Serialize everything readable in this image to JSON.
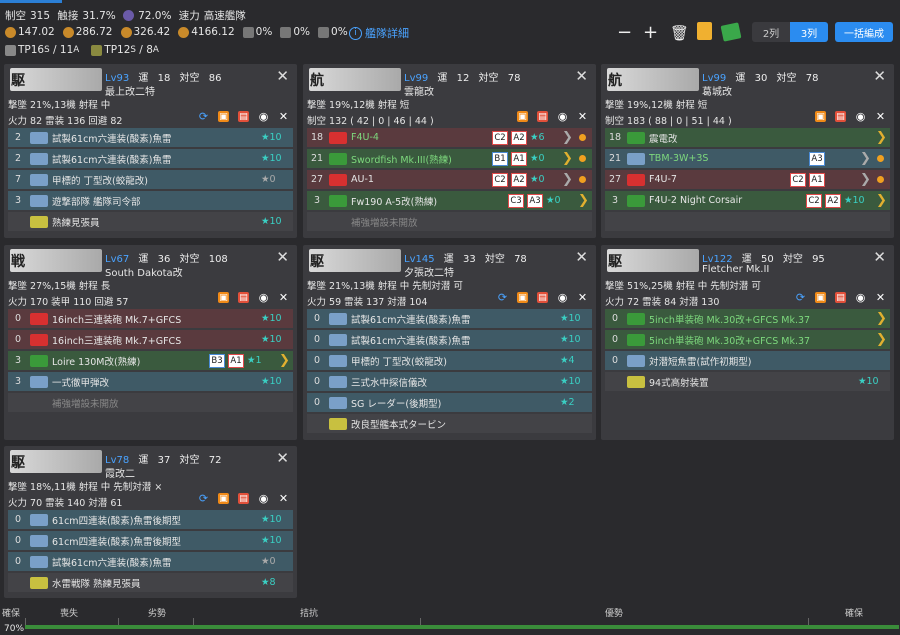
{
  "header": {
    "air_label": "制空",
    "air_value": "315",
    "contact_label": "触接",
    "contact_value": "31.7%",
    "ship_icon": "ship-emblem-icon",
    "unknown_value": "72.0%",
    "speed_label": "速力",
    "speed_value": "高速艦隊",
    "los": [
      "147.02",
      "286.72",
      "326.42",
      "4166.12"
    ],
    "fuel_pct": "0%",
    "ammo_pct": "0%",
    "steel_pct": "0%",
    "detail_link": "艦隊詳細",
    "col2": "2列",
    "col3": "3列",
    "bulk": "一括編成",
    "tp_label": "TP",
    "tp_s_value": "16",
    "tp_s_sub": "S",
    "tp_a_value": "11",
    "tp_a_sub": "A",
    "tp2_s_value": "12",
    "tp2_s_sub": "S",
    "tp2_a_value": "8",
    "tp2_a_sub": "A"
  },
  "ships": [
    {
      "banner": "駆",
      "level": "Lv93",
      "luck_label": "運",
      "luck": "18",
      "aa_label": "対空",
      "aa": "86",
      "name": "最上改二特",
      "line1": "撃墜 21%,13機  射程 中",
      "line2": "火力 82  雷装 136  回避 82",
      "equips": [
        {
          "slot": "2",
          "name": "試製61cm六連装(酸素)魚雷",
          "imp": "★10",
          "kind": "b"
        },
        {
          "slot": "2",
          "name": "試製61cm六連装(酸素)魚雷",
          "imp": "★10",
          "kind": "b"
        },
        {
          "slot": "7",
          "name": "甲標的 丁型改(蛟龍改)",
          "imp": "★0",
          "kind": "b",
          "gray": true
        },
        {
          "slot": "3",
          "name": "遊撃部隊 艦隊司令部",
          "imp": "",
          "kind": "b"
        },
        {
          "slot": "",
          "name": "熟練見張員",
          "imp": "★10",
          "kind": "ex"
        }
      ]
    },
    {
      "banner": "航",
      "level": "Lv99",
      "luck_label": "運",
      "luck": "12",
      "aa_label": "対空",
      "aa": "78",
      "name": "雲龍改",
      "line1": "撃墜 19%,12機  射程 短",
      "line2": "制空 132 ( 42 | 0 | 46 | 44 )",
      "equips": [
        {
          "slot": "18",
          "name": "F4U-4",
          "imp": "★6",
          "kind": "r",
          "green": true,
          "tags": [
            "C2",
            "A2"
          ]
        },
        {
          "slot": "21",
          "name": "Swordfish Mk.III(熟練)",
          "imp": "★0",
          "kind": "g",
          "green": true,
          "tags": [
            "B1",
            "A1"
          ]
        },
        {
          "slot": "27",
          "name": "AU-1",
          "imp": "★0",
          "kind": "r",
          "tags": [
            "C2",
            "A2"
          ]
        },
        {
          "slot": "3",
          "name": "Fw190 A-5改(熟練)",
          "imp": "★0",
          "kind": "g",
          "tags": [
            "C3",
            "A3"
          ]
        },
        {
          "slot": "",
          "name": "補強増設未開放",
          "imp": "",
          "kind": "ex",
          "dim": true
        }
      ]
    },
    {
      "banner": "航",
      "level": "Lv99",
      "luck_label": "運",
      "luck": "30",
      "aa_label": "対空",
      "aa": "78",
      "name": "葛城改",
      "line1": "撃墜 19%,12機  射程 短",
      "line2": "制空 183 ( 88 | 0 | 51 | 44 )",
      "equips": [
        {
          "slot": "18",
          "name": "震電改",
          "imp": "",
          "kind": "g"
        },
        {
          "slot": "21",
          "name": "TBM-3W+3S",
          "imp": "",
          "kind": "b",
          "green": true,
          "tags": [
            "A3"
          ]
        },
        {
          "slot": "27",
          "name": "F4U-7",
          "imp": "",
          "kind": "r",
          "tags": [
            "C2",
            "A1"
          ]
        },
        {
          "slot": "3",
          "name": "F4U-2 Night Corsair",
          "imp": "★10",
          "kind": "g",
          "tags": [
            "C2",
            "A2"
          ]
        },
        {
          "slot": "",
          "name": "",
          "imp": "",
          "kind": "ex"
        }
      ]
    },
    {
      "banner": "戦",
      "level": "Lv67",
      "luck_label": "運",
      "luck": "36",
      "aa_label": "対空",
      "aa": "108",
      "name": "South Dakota改",
      "line1": "撃墜 27%,15機  射程 長",
      "line2": "火力 170  装甲 110  回避 57",
      "equips": [
        {
          "slot": "0",
          "name": "16inch三連装砲 Mk.7+GFCS",
          "imp": "★10",
          "kind": "r"
        },
        {
          "slot": "0",
          "name": "16inch三連装砲 Mk.7+GFCS",
          "imp": "★10",
          "kind": "r"
        },
        {
          "slot": "3",
          "name": "Loire 130M改(熟練)",
          "imp": "★1",
          "kind": "g",
          "tags": [
            "B3",
            "A1"
          ]
        },
        {
          "slot": "3",
          "name": "一式徹甲弾改",
          "imp": "★10",
          "kind": "b"
        },
        {
          "slot": "",
          "name": "補強増設未開放",
          "imp": "",
          "kind": "ex",
          "dim": true
        }
      ]
    },
    {
      "banner": "駆",
      "level": "Lv145",
      "luck_label": "運",
      "luck": "33",
      "aa_label": "対空",
      "aa": "78",
      "name": "夕張改二特",
      "line1": "撃墜 21%,13機  射程 中  先制対潜 可",
      "line2": "火力 59  雷装 137  対潜 104",
      "equips": [
        {
          "slot": "0",
          "name": "試製61cm六連装(酸素)魚雷",
          "imp": "★10",
          "kind": "b"
        },
        {
          "slot": "0",
          "name": "試製61cm六連装(酸素)魚雷",
          "imp": "★10",
          "kind": "b"
        },
        {
          "slot": "0",
          "name": "甲標的 丁型改(蛟龍改)",
          "imp": "★4",
          "kind": "b"
        },
        {
          "slot": "0",
          "name": "三式水中探信儀改",
          "imp": "★10",
          "kind": "b"
        },
        {
          "slot": "0",
          "name": "SG レーダー(後期型)",
          "imp": "★2",
          "kind": "b"
        },
        {
          "slot": "",
          "name": "改良型艦本式タービン",
          "imp": "",
          "kind": "ex"
        }
      ]
    },
    {
      "banner": "駆",
      "level": "Lv122",
      "luck_label": "運",
      "luck": "50",
      "aa_label": "対空",
      "aa": "95",
      "name": "Fletcher Mk.II",
      "line1": "撃墜 51%,25機  射程 中  先制対潜 可",
      "line2": "火力 72  雷装 84  対潜 130",
      "equips": [
        {
          "slot": "0",
          "name": "5inch単装砲 Mk.30改+GFCS Mk.37",
          "imp": "",
          "kind": "g",
          "green": true
        },
        {
          "slot": "0",
          "name": "5inch単装砲 Mk.30改+GFCS Mk.37",
          "imp": "",
          "kind": "g",
          "green": true
        },
        {
          "slot": "0",
          "name": "対潜短魚雷(試作初期型)",
          "imp": "",
          "kind": "b"
        },
        {
          "slot": "",
          "name": "94式高射装置",
          "imp": "★10",
          "kind": "ex"
        }
      ]
    },
    {
      "banner": "駆",
      "level": "Lv78",
      "luck_label": "運",
      "luck": "37",
      "aa_label": "対空",
      "aa": "72",
      "name": "霞改二",
      "line1": "撃墜 18%,11機  射程 中  先制対潜 ×",
      "line2": "火力 70  雷装 140  対潜 61",
      "equips": [
        {
          "slot": "0",
          "name": "61cm四連装(酸素)魚雷後期型",
          "imp": "★10",
          "kind": "b"
        },
        {
          "slot": "0",
          "name": "61cm四連装(酸素)魚雷後期型",
          "imp": "★10",
          "kind": "b"
        },
        {
          "slot": "0",
          "name": "試製61cm六連装(酸素)魚雷",
          "imp": "★0",
          "kind": "b",
          "gray": true
        },
        {
          "slot": "",
          "name": "水雷戦隊 熟練見張員",
          "imp": "★8",
          "kind": "ex"
        }
      ]
    }
  ],
  "gauge": {
    "left_label": "確保",
    "pct": "70%",
    "labels": [
      "喪失",
      "劣勢",
      "拮抗",
      "優勢",
      "確保"
    ]
  }
}
